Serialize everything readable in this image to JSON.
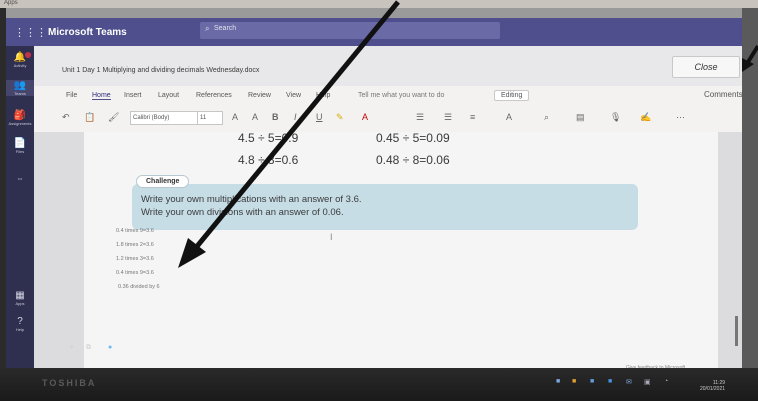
{
  "os": {
    "apps_label": "Apps"
  },
  "teams": {
    "app_title": "Microsoft Teams",
    "search_placeholder": "Search",
    "rail": [
      {
        "label": "Activity",
        "glyph": "🔔"
      },
      {
        "label": "Teams",
        "glyph": "👥"
      },
      {
        "label": "Assignments",
        "glyph": "🎒"
      },
      {
        "label": "Files",
        "glyph": "📄"
      },
      {
        "label": "...",
        "glyph": "•••"
      },
      {
        "label": "Apps",
        "glyph": "▦"
      },
      {
        "label": "Help",
        "glyph": "?"
      }
    ]
  },
  "file": {
    "name": "Unit 1 Day 1 Multiplying and dividing decimals Wednesday.docx",
    "close_label": "Close"
  },
  "ribbon": {
    "tabs": [
      "File",
      "Home",
      "Insert",
      "Layout",
      "References",
      "Review",
      "View",
      "Help"
    ],
    "active_tab": "Home",
    "tell_me": "Tell me what you want to do",
    "editing": "Editing",
    "comments": "Comments",
    "font_name": "Calibri (Body)",
    "font_size": "11"
  },
  "document": {
    "equations": [
      {
        "left": "4.5 ÷ 5=0.9",
        "right": "0.45 ÷ 5=0.09"
      },
      {
        "left": "4.8 ÷ 8=0.6",
        "right": "0.48 ÷ 8=0.06"
      }
    ],
    "challenge_label": "Challenge",
    "challenge_lines": [
      "Write your own multiplications with an answer of 3.6.",
      "Write your own divisions with an answer of 0.06."
    ],
    "answers": [
      "0.4 times 9=3.6",
      "1.8 times 2=3.6",
      "1.2 times 3=3.6",
      "0.4 times 9=3.6",
      "0.36 divided by 6"
    ],
    "feedback": "Give feedback to Microsoft"
  },
  "taskbar": {
    "brand": "TOSHIBA",
    "time": "11:29",
    "date": "20/01/2021"
  }
}
